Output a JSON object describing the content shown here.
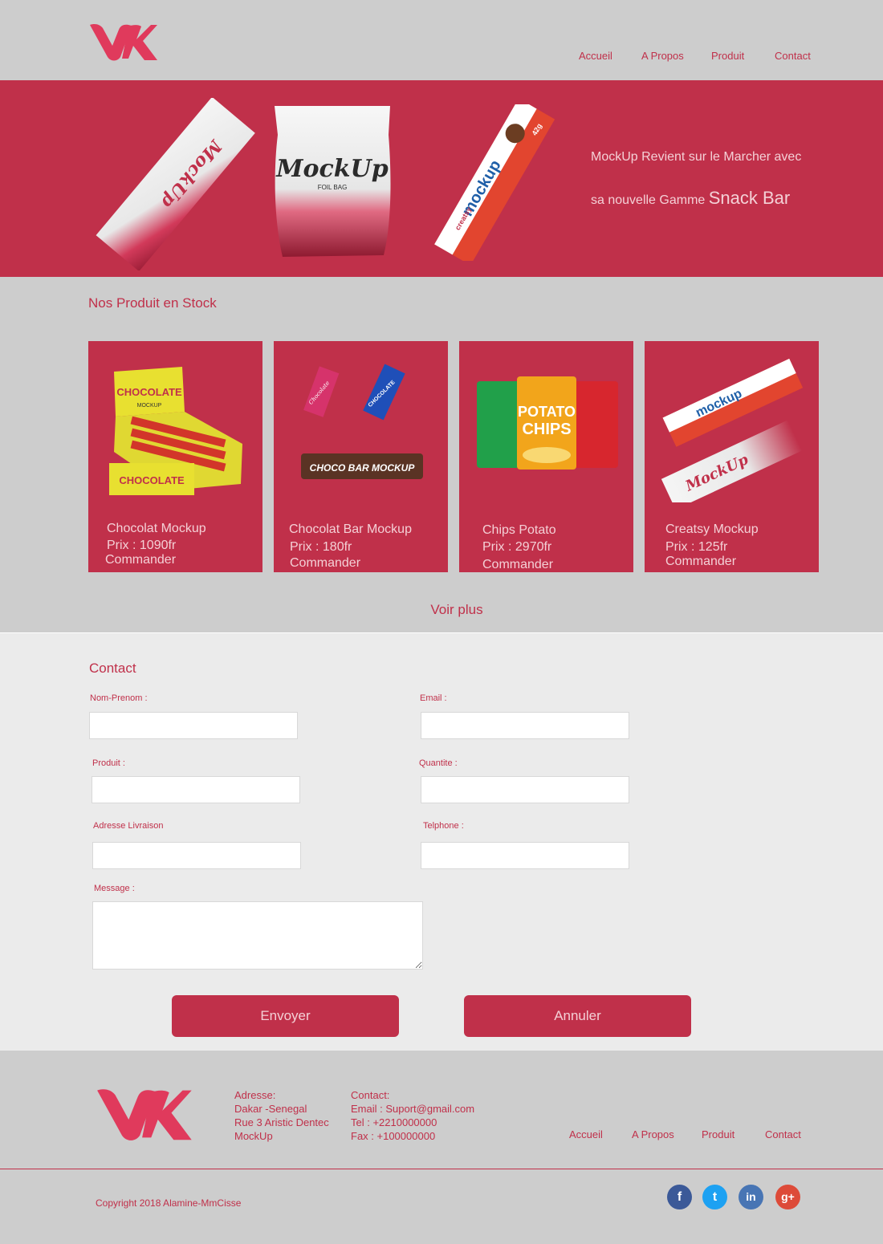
{
  "header": {
    "logo_icon": "vk-logo-icon",
    "nav": [
      "Accueil",
      "A Propos",
      "Produit",
      "Contact"
    ]
  },
  "hero": {
    "line1": "MockUp Revient sur le Marcher avec",
    "line2_prefix": "sa nouvelle Gamme",
    "line2_highlight": "Snack Bar",
    "package_labels": [
      "MockUp",
      "MockUp",
      "FOIL BAG",
      "mockup",
      "creatsy",
      "42g"
    ]
  },
  "products": {
    "title": "Nos Produit en Stock",
    "items": [
      {
        "name": "Chocolat Mockup",
        "price": "Prix : 1090fr",
        "cta": "Commander",
        "art": [
          "CHOCOLATE",
          "MOCKUP",
          "CHOCOLATE"
        ]
      },
      {
        "name": "Chocolat Bar Mockup",
        "price": "Prix : 180fr",
        "cta": "Commander",
        "art": [
          "Chocolate",
          "CHOCOLATE",
          "CHOCO BAR MOCKUP"
        ]
      },
      {
        "name": "Chips Potato",
        "price": "Prix : 2970fr",
        "cta": "Commander",
        "art": [
          "POTATO",
          "CHIPS"
        ]
      },
      {
        "name": "Creatsy Mockup",
        "price": "Prix : 125fr",
        "cta": "Commander",
        "art": [
          "mockup",
          "MockUp"
        ]
      }
    ],
    "see_more": "Voir plus"
  },
  "contact": {
    "title": "Contact",
    "labels": {
      "name": "Nom-Prenom :",
      "email": "Email :",
      "product": "Produit :",
      "quantity": "Quantite :",
      "address": "Adresse Livraison",
      "phone": "Telphone :",
      "message": "Message :"
    },
    "values": {
      "name": "",
      "email": "",
      "product": "",
      "quantity": "",
      "address": "",
      "phone": "",
      "message": ""
    },
    "submit": "Envoyer",
    "cancel": "Annuler"
  },
  "footer": {
    "address_title": "Adresse:",
    "address_lines": [
      "Dakar -Senegal",
      "Rue 3 Aristic Dentec",
      "MockUp"
    ],
    "contact_title": "Contact:",
    "contact_lines": [
      "Email : Suport@gmail.com",
      "Tel : +2210000000",
      "Fax : +100000000"
    ],
    "nav": [
      "Accueil",
      "A Propos",
      "Produit",
      "Contact"
    ],
    "copyright": "Copyright 2018 Alamine-MmCisse",
    "social": [
      {
        "icon": "facebook-icon",
        "glyph": "f",
        "color": "#3b5998"
      },
      {
        "icon": "twitter-icon",
        "glyph": "t",
        "color": "#1da1f2"
      },
      {
        "icon": "linkedin-icon",
        "glyph": "in",
        "color": "#4875b4"
      },
      {
        "icon": "google-plus-icon",
        "glyph": "g+",
        "color": "#dd4b39"
      }
    ]
  },
  "colors": {
    "brand": "#c0304a",
    "background": "#cdcdcd",
    "contact_bg": "#ebebeb"
  }
}
